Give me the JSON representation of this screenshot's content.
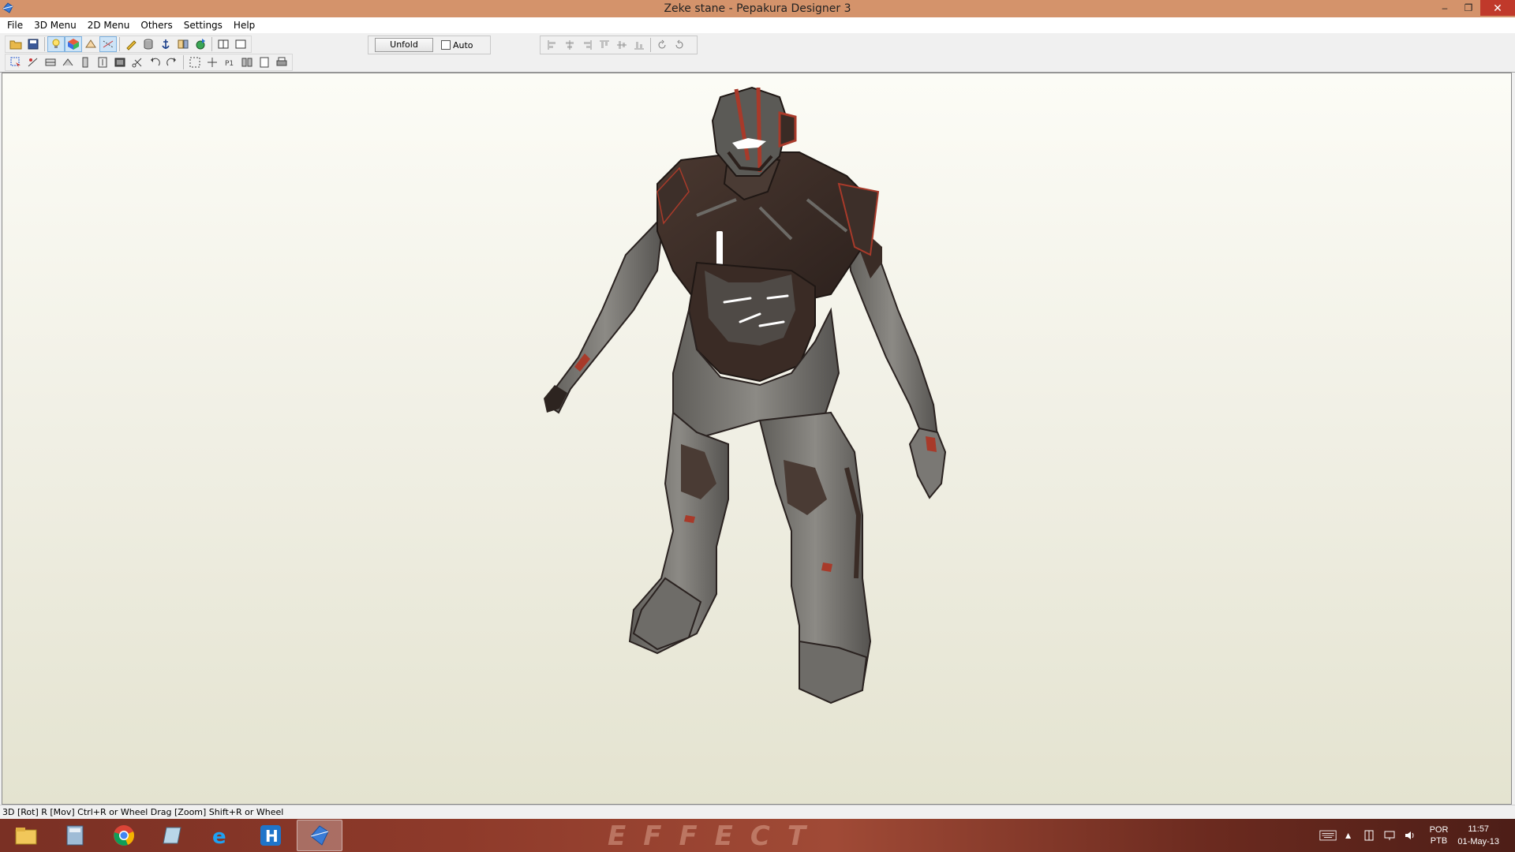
{
  "window": {
    "title": "Zeke stane - Pepakura Designer 3",
    "minimize": "–",
    "restore": "❐",
    "close": "✕"
  },
  "menu": {
    "items": [
      "File",
      "3D Menu",
      "2D Menu",
      "Others",
      "Settings",
      "Help"
    ]
  },
  "toolbar": {
    "unfold_label": "Unfold",
    "auto_label": "Auto",
    "auto_checked": false
  },
  "status": {
    "text": "3D [Rot] R [Mov] Ctrl+R or Wheel Drag [Zoom] Shift+R or Wheel"
  },
  "taskbar": {
    "watermark": "EFFECT",
    "apps": [
      "file-explorer-icon",
      "calculator-icon",
      "chrome-icon",
      "notes-icon",
      "internet-explorer-icon",
      "h-app-icon",
      "pepakura-icon"
    ],
    "active_app": "pepakura-icon",
    "lang_top": "POR",
    "lang_bottom": "PTB",
    "time": "11:57",
    "date": "01-May-13"
  },
  "colors": {
    "titlebar": "#d4936b",
    "armor_dark": "#3e2e28",
    "armor_grey": "#7d7b76",
    "accent_red": "#a83a2a",
    "glow": "#ffffff"
  }
}
